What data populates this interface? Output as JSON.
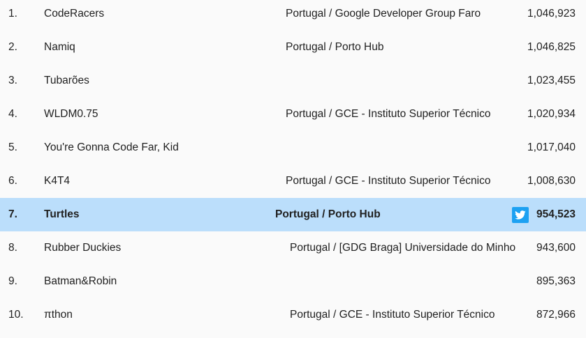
{
  "leaderboard": {
    "rows": [
      {
        "rank": "1.",
        "team": "CodeRacers",
        "location": "Portugal / Google Developer Group Faro",
        "score": "1,046,923"
      },
      {
        "rank": "2.",
        "team": "Namiq",
        "location": "Portugal / Porto Hub",
        "score": "1,046,825"
      },
      {
        "rank": "3.",
        "team": "Tubarões",
        "location": "",
        "score": "1,023,455"
      },
      {
        "rank": "4.",
        "team": "WLDM0.75",
        "location": "Portugal / GCE - Instituto Superior Técnico",
        "score": "1,020,934"
      },
      {
        "rank": "5.",
        "team": "You're Gonna Code Far, Kid",
        "location": "",
        "score": "1,017,040"
      },
      {
        "rank": "6.",
        "team": "K4T4",
        "location": "Portugal / GCE - Instituto Superior Técnico",
        "score": "1,008,630"
      },
      {
        "rank": "7.",
        "team": "Turtles",
        "location": "Portugal / Porto Hub",
        "score": "954,523",
        "highlighted": true,
        "share_icon": "twitter-icon"
      },
      {
        "rank": "8.",
        "team": "Rubber Duckies",
        "location": "Portugal / [GDG Braga] Universidade do Minho",
        "score": "943,600"
      },
      {
        "rank": "9.",
        "team": "Batman&Robin",
        "location": "",
        "score": "895,363"
      },
      {
        "rank": "10.",
        "team": "πthon",
        "location": "Portugal / GCE - Instituto Superior Técnico",
        "score": "872,966"
      }
    ]
  },
  "colors": {
    "background": "#fafafa",
    "highlight": "#bbdefb",
    "twitter": "#1da1f2",
    "text": "#212121"
  }
}
